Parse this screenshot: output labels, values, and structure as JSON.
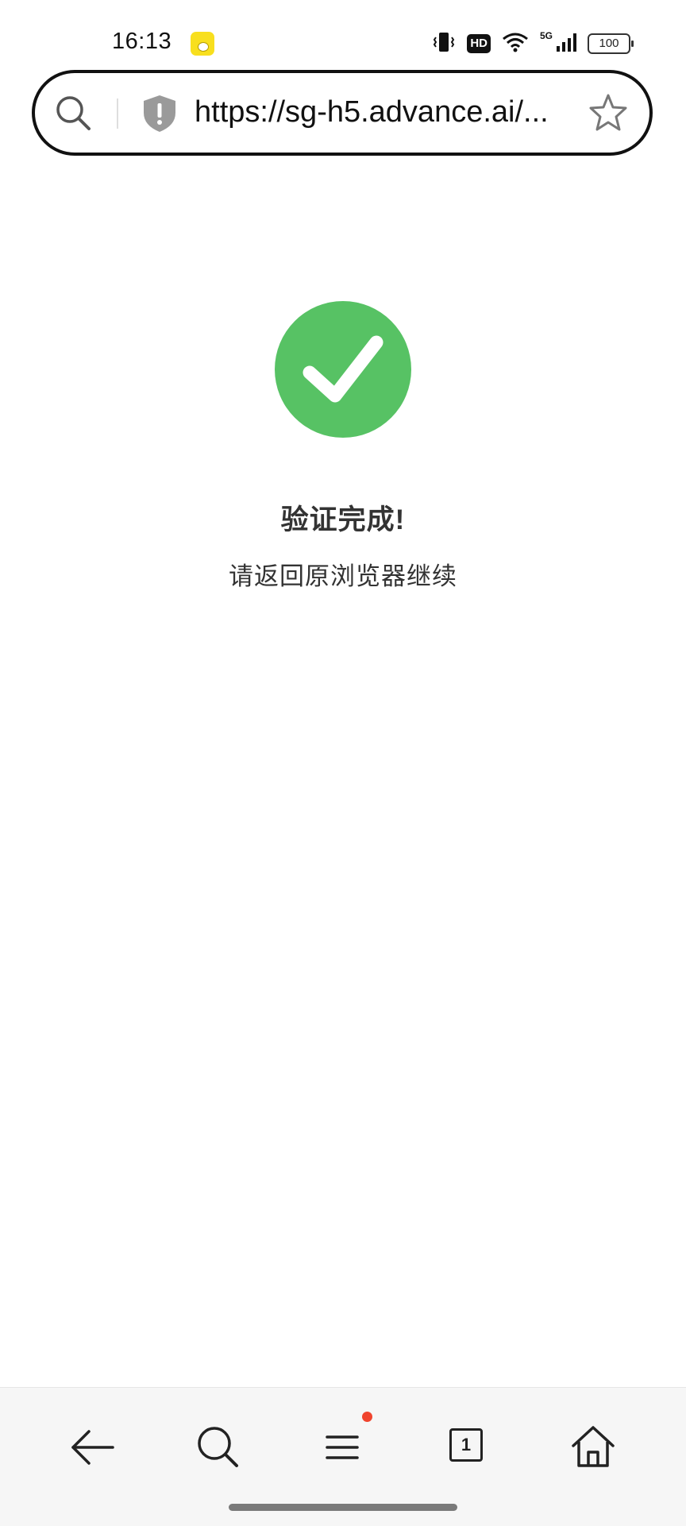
{
  "status_bar": {
    "time": "16:13",
    "notification_app_icon": "yellow-app-icon",
    "icons": [
      "vibrate-icon",
      "hd-icon",
      "wifi-icon",
      "5g-signal-icon",
      "battery-icon"
    ],
    "hd_label": "HD",
    "network_label": "5G",
    "battery_level": "100"
  },
  "address_bar": {
    "search_icon": "search-icon",
    "security_icon": "warning-shield-icon",
    "url": "https://sg-h5.advance.ai/...",
    "bookmark_icon": "star-icon"
  },
  "main": {
    "status_icon": "check-circle-icon",
    "status_color": "#57c264",
    "title": "验证完成!",
    "subtitle": "请返回原浏览器继续"
  },
  "bottom_nav": {
    "items": [
      {
        "name": "back",
        "icon": "arrow-left-icon"
      },
      {
        "name": "search",
        "icon": "search-icon"
      },
      {
        "name": "menu",
        "icon": "menu-icon",
        "has_badge": true,
        "badge_color": "#f0442e"
      },
      {
        "name": "tabs",
        "icon": "tabs-icon",
        "count": "1"
      },
      {
        "name": "home",
        "icon": "home-icon"
      }
    ]
  }
}
